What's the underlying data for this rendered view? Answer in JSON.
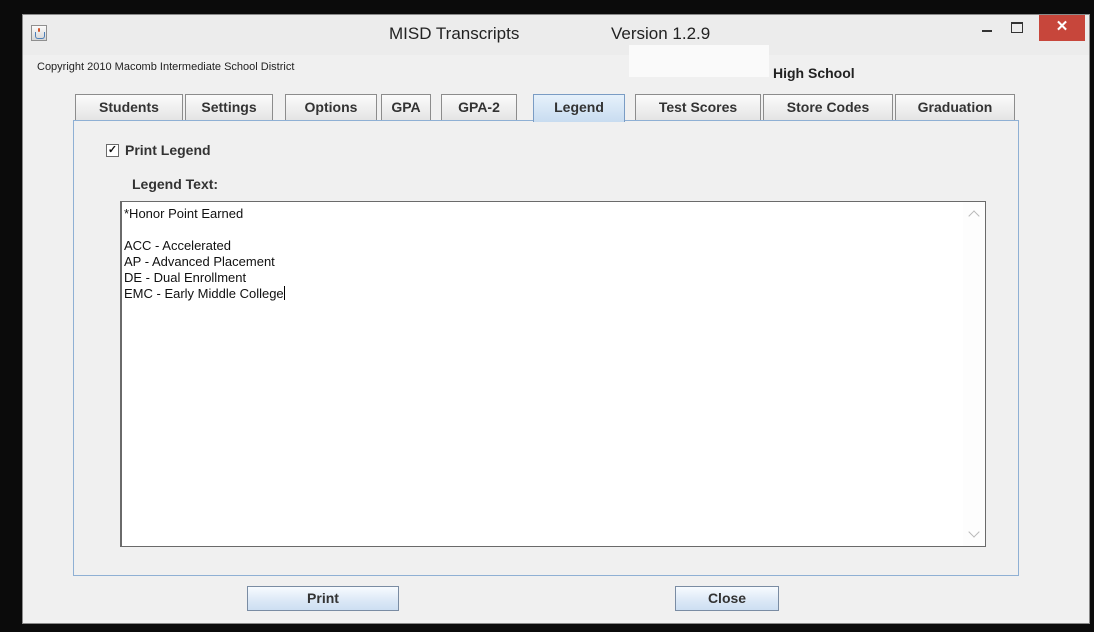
{
  "window": {
    "title": "MISD Transcripts",
    "version": "Version 1.2.9",
    "close_glyph": "✕"
  },
  "header": {
    "copyright": "Copyright 2010 Macomb Intermediate School District",
    "school": "High School"
  },
  "tabs": [
    {
      "label": "Students"
    },
    {
      "label": "Settings"
    },
    {
      "label": "Options"
    },
    {
      "label": "GPA"
    },
    {
      "label": "GPA-2"
    },
    {
      "label": "Legend",
      "active": true
    },
    {
      "label": "Test Scores"
    },
    {
      "label": "Store Codes"
    },
    {
      "label": "Graduation"
    }
  ],
  "legend_panel": {
    "print_legend_label": "Print Legend",
    "print_legend_checked": true,
    "check_glyph": "✓",
    "legend_text_label": "Legend Text:",
    "legend_text": "*Honor Point Earned\n\nACC - Accelerated\nAP - Advanced Placement\nDE - Dual Enrollment\nEMC - Early Middle College"
  },
  "buttons": {
    "print": "Print",
    "close": "Close"
  },
  "icons": {
    "app": "java-cup-icon",
    "minimize": "minimize-icon",
    "maximize": "maximize-icon",
    "close": "close-icon"
  },
  "colors": {
    "close_button": "#c7463b",
    "active_tab": "#c8dcf0",
    "panel_border": "#8fb0d4"
  }
}
